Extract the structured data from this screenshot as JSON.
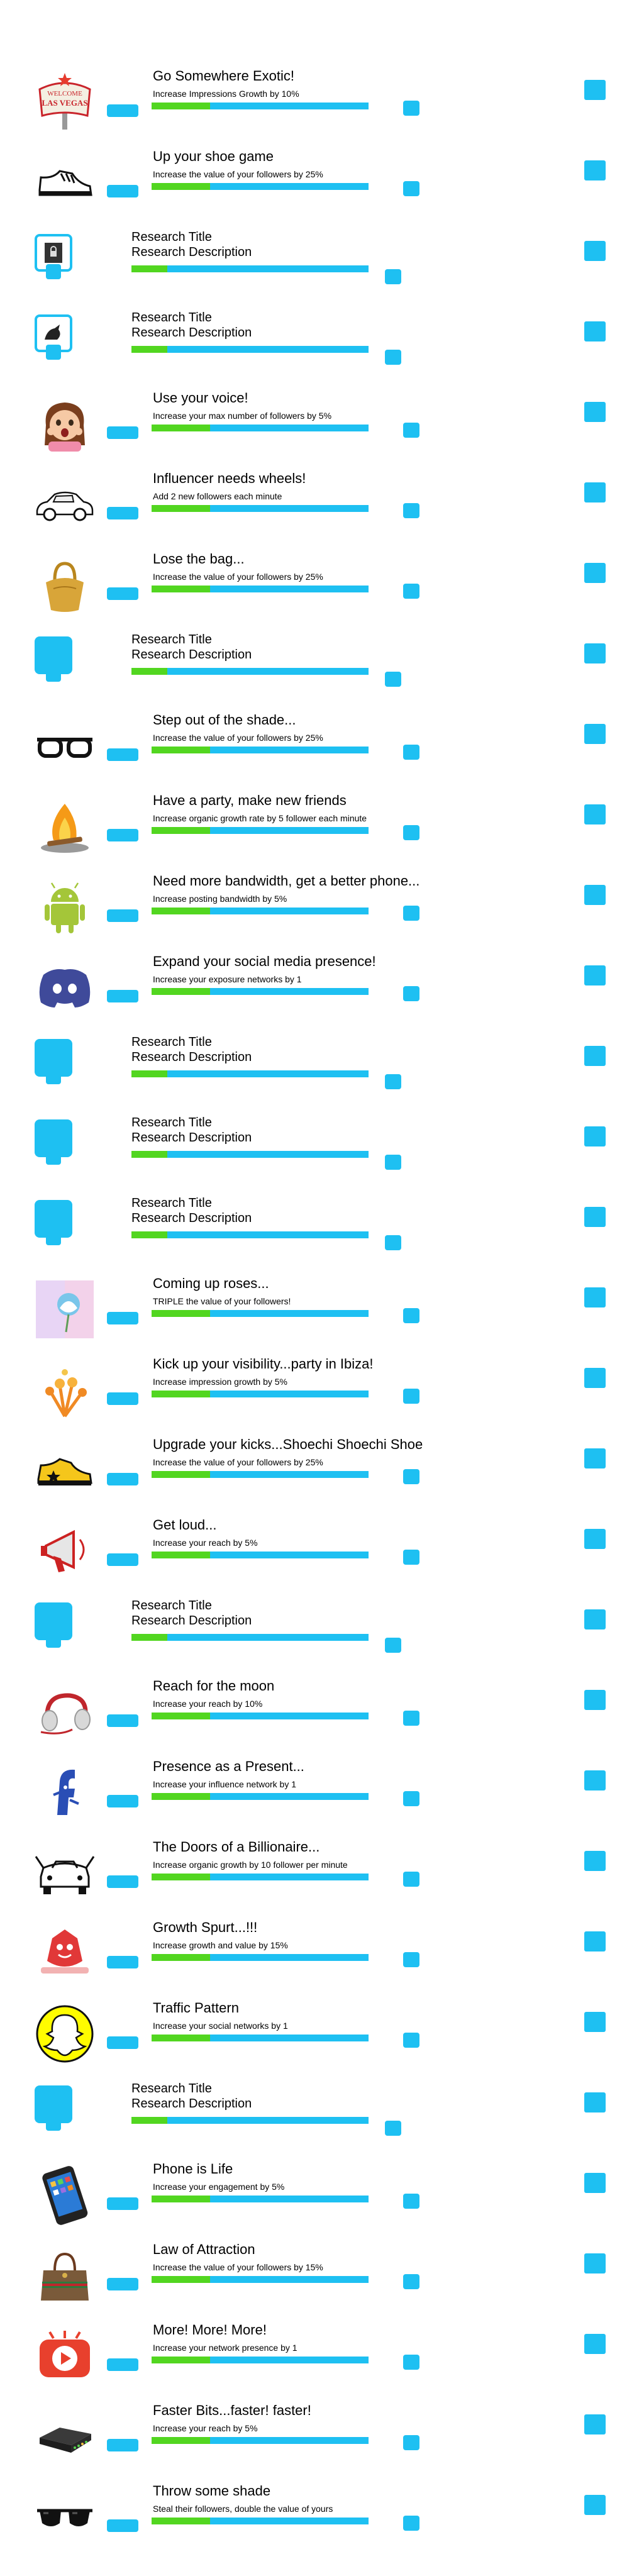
{
  "colors": {
    "accent": "#1ec0f2",
    "progress": "#52d620",
    "background": "#ffffff"
  },
  "upgrades": [
    {
      "kind": "item",
      "icon": "las-vegas-sign-icon",
      "title": "Go Somewhere Exotic!",
      "description": "Increase Impressions Growth by 10%",
      "progress": 0.27
    },
    {
      "kind": "item",
      "icon": "sneaker-icon",
      "title": "Up your shoe game",
      "description": "Increase the value of your followers by 25%",
      "progress": 0.27
    },
    {
      "kind": "research",
      "icon": "locked-book-icon",
      "title": "Research Title",
      "description": "Research Description",
      "progress": 0.15
    },
    {
      "kind": "research",
      "icon": "bird-icon",
      "title": "Research Title",
      "description": "Research Description",
      "progress": 0.15
    },
    {
      "kind": "item",
      "icon": "girl-emoji-icon",
      "title": "Use your voice!",
      "description": "Increase your max number of followers by 5%",
      "progress": 0.27
    },
    {
      "kind": "item",
      "icon": "car-icon",
      "title": "Influencer needs wheels!",
      "description": "Add 2 new followers each minute",
      "progress": 0.27
    },
    {
      "kind": "item",
      "icon": "handbag-icon",
      "title": "Lose the bag...",
      "description": "Increase the value of your followers by 25%",
      "progress": 0.27
    },
    {
      "kind": "research",
      "icon": "",
      "title": "Research Title",
      "description": "Research Description",
      "progress": 0.15
    },
    {
      "kind": "item",
      "icon": "sunglasses-icon",
      "title": "Step out of the shade...",
      "description": "Increase the value of your followers by 25%",
      "progress": 0.27
    },
    {
      "kind": "item",
      "icon": "campfire-icon",
      "title": "Have a party, make new friends",
      "description": "Increase organic growth rate by 5 follower each minute",
      "progress": 0.27
    },
    {
      "kind": "item",
      "icon": "android-icon",
      "title": "Need more bandwidth, get a better phone...",
      "description": "Increase posting bandwidth by 5%",
      "progress": 0.27
    },
    {
      "kind": "item",
      "icon": "discord-icon",
      "title": "Expand your social media presence!",
      "description": "Increase your exposure networks by 1",
      "progress": 0.27
    },
    {
      "kind": "research",
      "icon": "",
      "title": "Research Title",
      "description": "Research Description",
      "progress": 0.15
    },
    {
      "kind": "research",
      "icon": "",
      "title": "Research Title",
      "description": "Research Description",
      "progress": 0.15
    },
    {
      "kind": "research",
      "icon": "",
      "title": "Research Title",
      "description": "Research Description",
      "progress": 0.15
    },
    {
      "kind": "item",
      "icon": "roses-icon",
      "title": "Coming up roses...",
      "description": "TRIPLE the value of your followers!",
      "progress": 0.27
    },
    {
      "kind": "item",
      "icon": "party-icon",
      "title": "Kick up your visibility...party in Ibiza!",
      "description": "Increase impression growth by 5%",
      "progress": 0.27
    },
    {
      "kind": "item",
      "icon": "yellow-shoe-icon",
      "title": "Upgrade your kicks...Shoechi Shoechi Shoe",
      "description": "Increase the value of your followers by 25%",
      "progress": 0.27
    },
    {
      "kind": "item",
      "icon": "megaphone-icon",
      "title": "Get loud...",
      "description": "Increase your reach by 5%",
      "progress": 0.27
    },
    {
      "kind": "research",
      "icon": "",
      "title": "Research Title",
      "description": "Research Description",
      "progress": 0.15
    },
    {
      "kind": "item",
      "icon": "headphones-icon",
      "title": "Reach for the moon",
      "description": "Increase your reach by 10%",
      "progress": 0.27
    },
    {
      "kind": "item",
      "icon": "facebook-mascot-icon",
      "title": "Presence as a Present...",
      "description": "Increase your influence network by 1",
      "progress": 0.27
    },
    {
      "kind": "item",
      "icon": "supercar-icon",
      "title": "The Doors of a Billionaire...",
      "description": "Increase organic growth by 10 follower per minute",
      "progress": 0.27
    },
    {
      "kind": "item",
      "icon": "growth-mascot-icon",
      "title": "Growth Spurt...!!!",
      "description": "Increase growth and value by 15%",
      "progress": 0.27
    },
    {
      "kind": "item",
      "icon": "snapchat-icon",
      "title": "Traffic Pattern",
      "description": "Increase your social networks by 1",
      "progress": 0.27
    },
    {
      "kind": "research",
      "icon": "",
      "title": "Research Title",
      "description": "Research Description",
      "progress": 0.15
    },
    {
      "kind": "item",
      "icon": "smartphone-icon",
      "title": "Phone is Life",
      "description": "Increase your engagement by 5%",
      "progress": 0.27
    },
    {
      "kind": "item",
      "icon": "designer-bag-icon",
      "title": "Law of Attraction",
      "description": "Increase the value of your followers by 15%",
      "progress": 0.27
    },
    {
      "kind": "item",
      "icon": "video-player-icon",
      "title": "More! More! More!",
      "description": "Increase your network presence by 1",
      "progress": 0.27
    },
    {
      "kind": "item",
      "icon": "router-icon",
      "title": "Faster Bits...faster! faster!",
      "description": "Increase your reach by 5%",
      "progress": 0.27
    },
    {
      "kind": "item",
      "icon": "shades-icon",
      "title": "Throw some shade",
      "description": "Steal their followers, double the value of yours",
      "progress": 0.27
    }
  ]
}
